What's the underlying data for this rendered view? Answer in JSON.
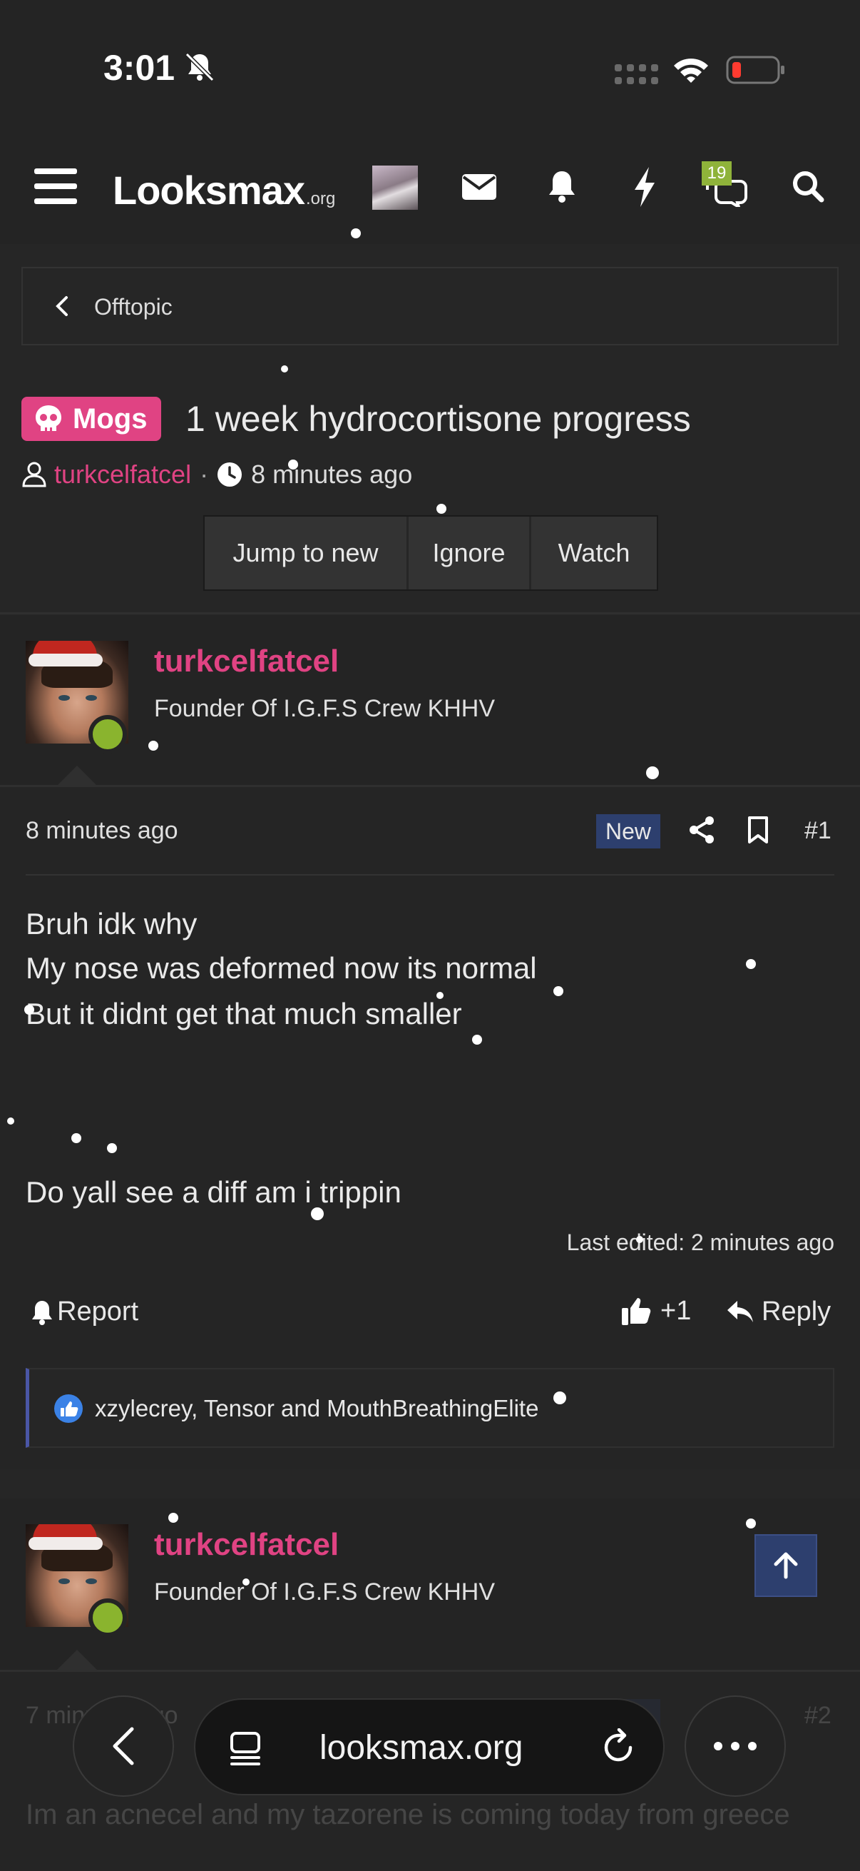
{
  "status_bar": {
    "time": "3:01",
    "icons": [
      "bell-slash-icon",
      "cellular-signal-icon",
      "wifi-icon",
      "battery-low-icon"
    ]
  },
  "nav": {
    "logo_text": "Looksmax",
    "logo_tld": ".org",
    "conversations_badge": "19",
    "icons": [
      "menu-icon",
      "user-avatar-thumb",
      "envelope-icon",
      "bell-icon",
      "bolt-icon",
      "chat-bubbles-icon",
      "search-icon"
    ]
  },
  "breadcrumb": {
    "label": "Offtopic"
  },
  "thread": {
    "prefix": "Mogs",
    "title": "1 week hydrocortisone progress",
    "author": "turkcelfatcel",
    "time": "8 minutes ago",
    "buttons": {
      "jump": "Jump to new",
      "ignore": "Ignore",
      "watch": "Watch"
    }
  },
  "post1": {
    "username": "turkcelfatcel",
    "user_title": "Founder Of I.G.F.S Crew KHHV",
    "date": "8 minutes ago",
    "badge": "New",
    "number": "#1",
    "lines": [
      "Bruh idk why",
      "My nose was deformed now its normal",
      "But it didnt get that much smaller",
      "Do yall see a diff am i trippin"
    ],
    "last_edited": "Last edited: 2 minutes ago",
    "actions": {
      "report": "Report",
      "like_count": "+1",
      "reply": "Reply"
    },
    "reactions": "xzylecrey, Tensor and MouthBreathingElite"
  },
  "post2": {
    "username": "turkcelfatcel",
    "user_title": "Founder Of I.G.F.S Crew KHHV",
    "date": "7 minutes ago",
    "number": "#2",
    "text": "Im an acnecel and my tazorene is coming today from greece"
  },
  "browser": {
    "url": "looksmax.org"
  },
  "colors": {
    "background": "#262626",
    "panel": "#242424",
    "accent_pink": "#e04383",
    "badge_blue": "#2d3f6e",
    "online_green": "#8ab42e",
    "badge_green": "#8fb33a"
  }
}
